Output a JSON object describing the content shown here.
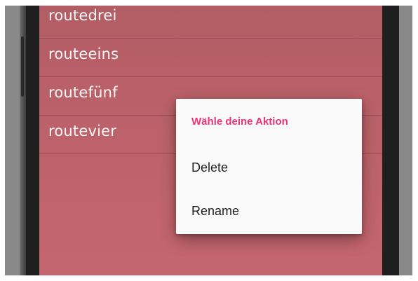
{
  "colors": {
    "screen_background": "#c4666e",
    "dialog_background": "#fafafa",
    "dialog_title": "#e8357a",
    "route_text": "#ffffff",
    "option_text": "#212121"
  },
  "routes": [
    {
      "label": "routedrei"
    },
    {
      "label": "routeeins"
    },
    {
      "label": "routefünf"
    },
    {
      "label": "routevier"
    }
  ],
  "dialog": {
    "title": "Wähle deine Aktion",
    "options": [
      {
        "label": "Delete"
      },
      {
        "label": "Rename"
      }
    ]
  }
}
